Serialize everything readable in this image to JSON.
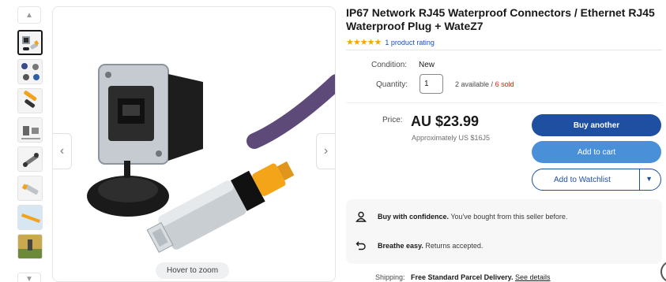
{
  "thumbnails": {
    "count": 8,
    "active_index": 0
  },
  "main_image": {
    "zoom_hint": "Hover to zoom"
  },
  "product": {
    "title": "IP67 Network RJ45 Waterproof Connectors / Ethernet RJ45 Waterproof Plug + WateZ7",
    "stars": "★★★★★",
    "rating_count_text": "1 product rating"
  },
  "details": {
    "condition_label": "Condition:",
    "condition_value": "New",
    "quantity_label": "Quantity:",
    "quantity_value": "1",
    "available_text": "2 available /",
    "sold_text": "6 sold"
  },
  "price": {
    "label": "Price:",
    "value": "AU $23.99",
    "approx": "Approximately US $16J5"
  },
  "actions": {
    "buy_label": "Buy another",
    "cart_label": "Add to cart",
    "watch_label": "Add to Watchlist"
  },
  "confidence": {
    "row1_bold": "Buy with confidence.",
    "row1_text": "You've bought from this seller before.",
    "row2_bold": "Breathe easy.",
    "row2_text": "Returns accepted."
  },
  "shipping": {
    "label": "Shipping:",
    "value": "Free Standard Parcel Delivery.",
    "link": "See details"
  },
  "colors": {
    "primary": "#1f4fa1",
    "secondary": "#4a90d9",
    "sold": "#d81e05",
    "stars": "#f2a900"
  }
}
